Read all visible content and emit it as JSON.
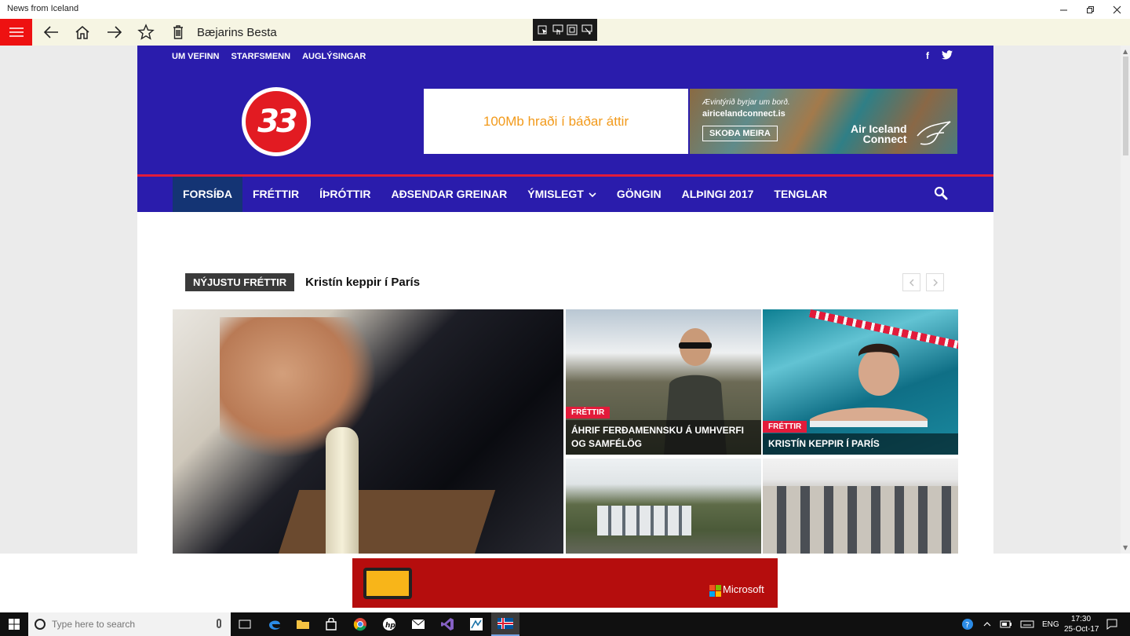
{
  "window": {
    "title": "News from Iceland"
  },
  "app": {
    "title": "Bæjarins Besta",
    "icons": [
      "hamburger-menu-icon",
      "back-arrow-icon",
      "home-icon",
      "forward-arrow-icon",
      "star-icon",
      "trash-icon"
    ]
  },
  "site": {
    "topnav": [
      "UM VEFINN",
      "STARFSMENN",
      "AUGLÝSINGAR"
    ],
    "social": [
      "f",
      "twitter"
    ],
    "logo_text": "33",
    "ad_left": "100Mb hraði í báðar áttir",
    "ad_right": {
      "line1": "Ævintýrið byrjar um borð.",
      "line2": "airicelandconnect.is",
      "button": "SKOÐA MEIRA",
      "brand1": "Air Iceland",
      "brand2": "Connect"
    },
    "mainnav": [
      "FORSÍÐA",
      "FRÉTTIR",
      "ÍÞRÓTTIR",
      "AÐSENDAR GREINAR",
      "ÝMISLEGT",
      "GÖNGIN",
      "ALÞINGI 2017",
      "TENGLAR"
    ],
    "ticker": {
      "label": "NÝJUSTU FRÉTTIR",
      "headline": "Kristín keppir í París"
    },
    "tiles": [
      {
        "category": "FRÉTTIR",
        "caption": "ÁHRIF FERÐAMENNSKU Á UMHVERFI OG SAMFÉLÖG"
      },
      {
        "category": "FRÉTTIR",
        "caption": "KRISTÍN KEPPIR Í PARÍS"
      }
    ]
  },
  "ad_bottom": {
    "brand": "Microsoft",
    "colors": {
      "red": "#f25022",
      "green": "#7fba00",
      "blue": "#00a4ef",
      "yellow": "#ffb900"
    }
  },
  "taskbar": {
    "search_placeholder": "Type here to search",
    "language": "ENG",
    "time": "17:30",
    "date": "25-Oct-17"
  },
  "colors": {
    "site_blue": "#2a1cac",
    "accent_red": "#e21b3a",
    "active_nav": "#143474"
  }
}
